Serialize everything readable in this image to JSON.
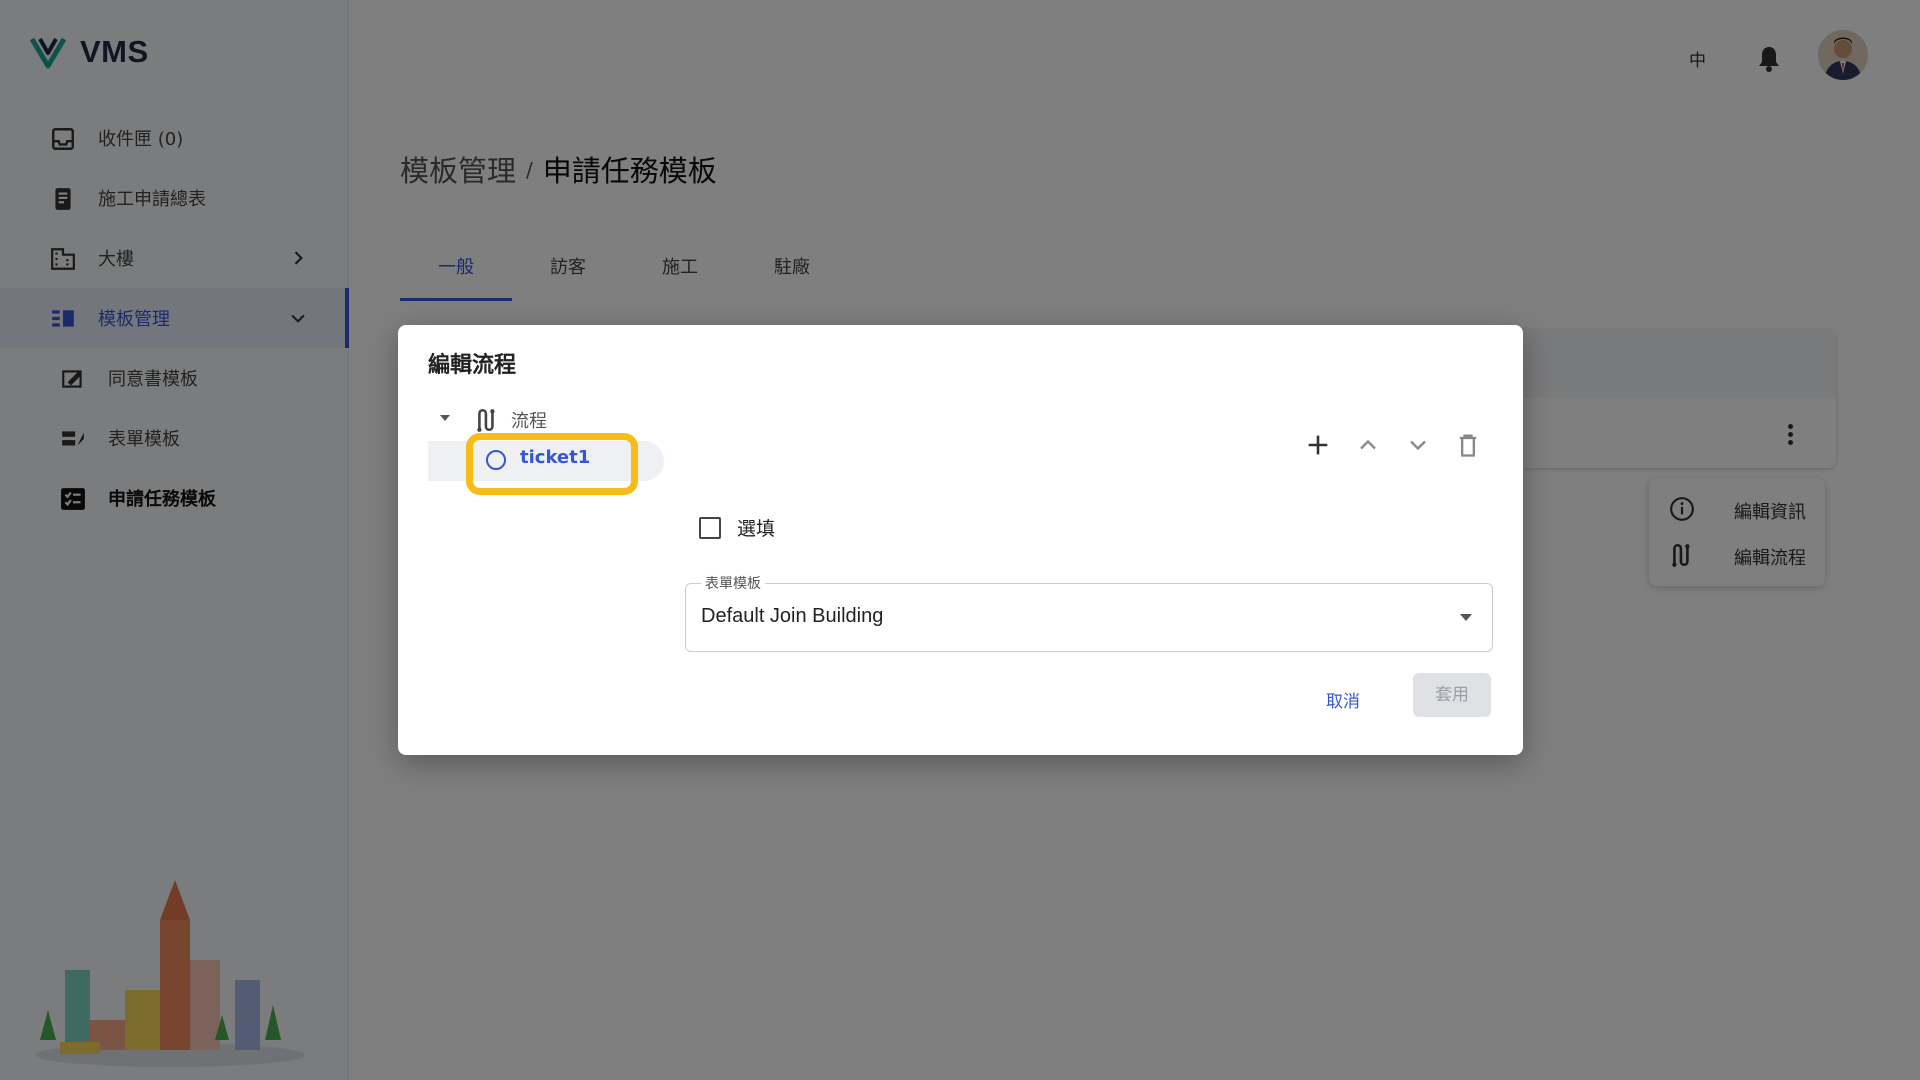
{
  "app": {
    "brand": "VMS",
    "lang_toggle": "中"
  },
  "sidebar": {
    "items": [
      {
        "label": "收件匣 (0)",
        "icon": "inbox-icon"
      },
      {
        "label": "施工申請總表",
        "icon": "document-icon"
      },
      {
        "label": "大樓",
        "icon": "building-icon"
      },
      {
        "label": "模板管理",
        "icon": "template-icon"
      },
      {
        "label": "同意書模板",
        "icon": "consent-icon"
      },
      {
        "label": "表單模板",
        "icon": "form-icon"
      },
      {
        "label": "申請任務模板",
        "icon": "task-template-icon"
      }
    ]
  },
  "breadcrumb": {
    "parent": "模板管理",
    "separator": "/",
    "current": "申請任務模板"
  },
  "tabs": [
    "一般",
    "訪客",
    "施工",
    "駐廠"
  ],
  "context_menu": {
    "items": [
      "編輯資訊",
      "編輯流程"
    ]
  },
  "dialog": {
    "title": "編輯流程",
    "tree_root_label": "流程",
    "selected_node": "ticket1",
    "optional_label": "選填",
    "form_template_label": "表單模板",
    "form_template_value": "Default Join Building",
    "cancel_label": "取消",
    "apply_label": "套用"
  },
  "colors": {
    "accent": "#3557d6",
    "highlight": "#f7bc16"
  }
}
